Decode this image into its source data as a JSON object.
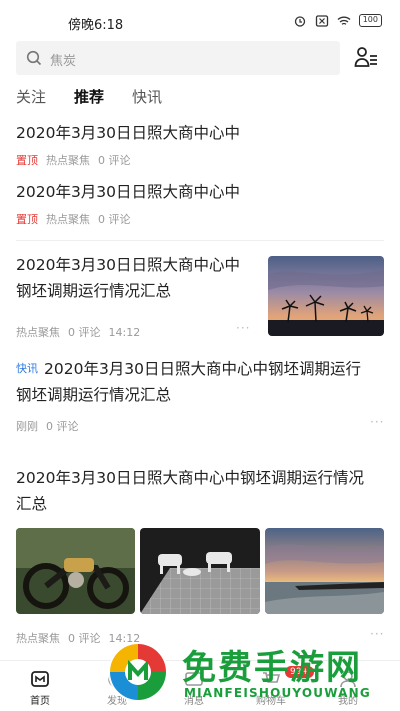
{
  "status_bar": {
    "time": "傍晚6:18",
    "battery": "100"
  },
  "search": {
    "placeholder": "焦炭"
  },
  "tabs": [
    {
      "label": "关注"
    },
    {
      "label": "推荐"
    },
    {
      "label": "快讯"
    }
  ],
  "feed": {
    "item1": {
      "title": "2020年3月30日日照大商中心中",
      "pin": "置顶",
      "source": "热点聚焦",
      "comments": "0 评论"
    },
    "item2": {
      "title": "2020年3月30日日照大商中心中",
      "pin": "置顶",
      "source": "热点聚焦",
      "comments": "0 评论"
    },
    "item3": {
      "title_line1": "2020年3月30日日照大商中心中",
      "title_line2": "钢坯调期运行情况汇总",
      "source": "热点聚焦",
      "comments": "0 评论",
      "time": "14:12",
      "more": "···"
    },
    "item4": {
      "badge": "快讯",
      "title_line1": "2020年3月30日日照大商中心中钢坯调期运行",
      "title_line2": "钢坯调期运行情况汇总",
      "source": "刚刚",
      "comments": "0 评论",
      "more": "···"
    },
    "item5": {
      "title_line1": "2020年3月30日日照大商中心中钢坯调期运行情况",
      "title_line2": "汇总",
      "source": "热点聚焦",
      "comments": "0 评论",
      "time": "14:12",
      "more": "···"
    }
  },
  "bottom_nav": [
    {
      "label": "首页",
      "icon": "home-icon"
    },
    {
      "label": "发现",
      "icon": "discover-icon"
    },
    {
      "label": "消息",
      "icon": "message-icon"
    },
    {
      "label": "购物车",
      "icon": "cart-icon"
    },
    {
      "label": "我的",
      "icon": "profile-icon"
    }
  ],
  "cart_badge": "99+",
  "watermark": {
    "title": "免费手游网",
    "subtitle": "MIANFEISHOUYOUWANG"
  },
  "colors": {
    "pin": "#e53935",
    "kuaixun": "#2f7be0",
    "watermark": "#1a9e3b"
  }
}
